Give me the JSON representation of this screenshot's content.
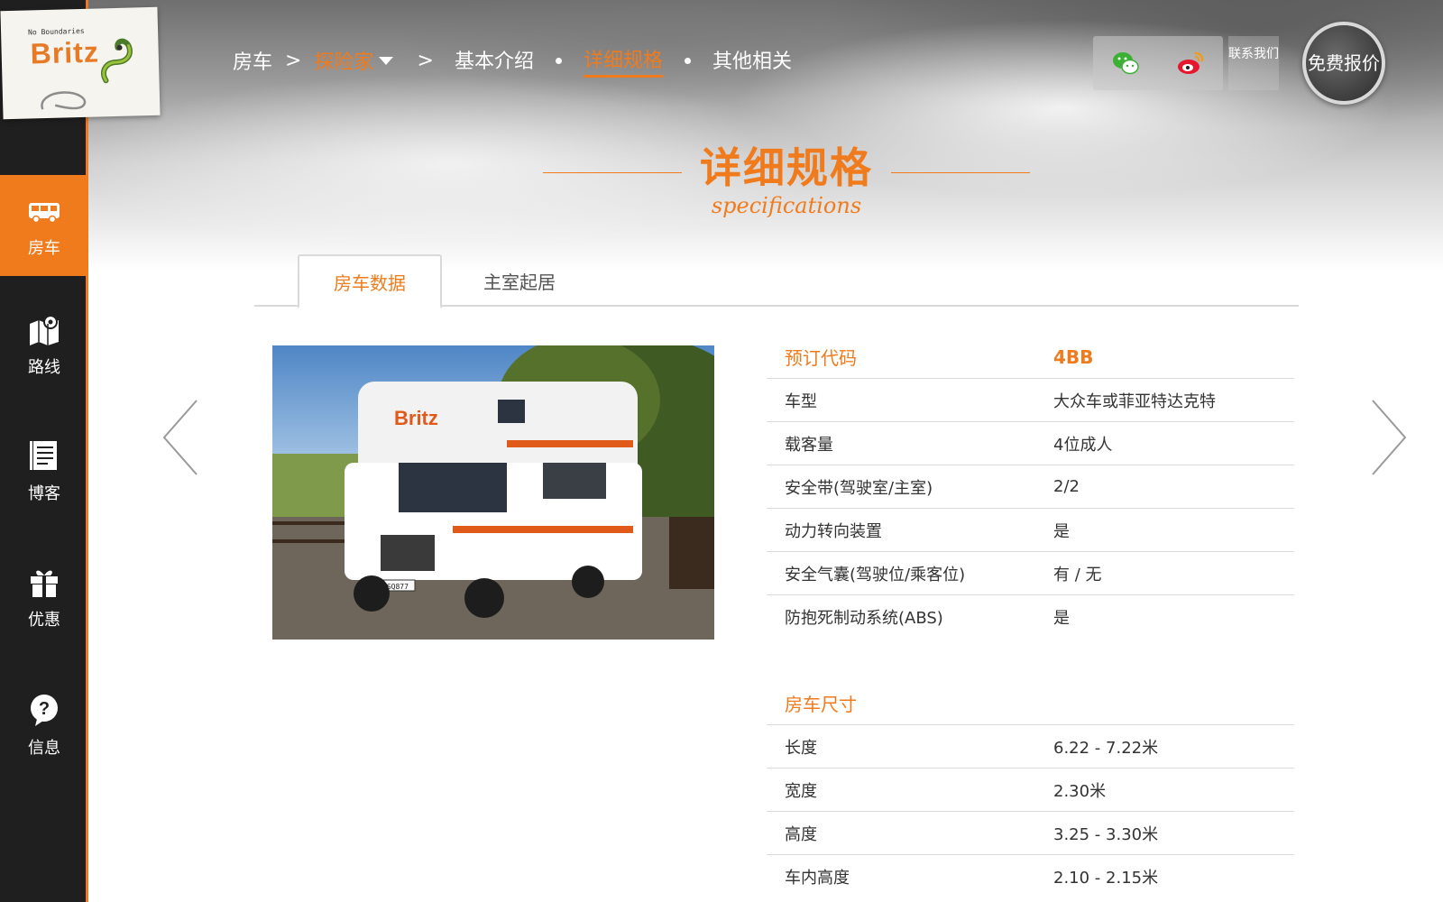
{
  "logo": {
    "tagline": "No Boundaries",
    "brand": "Britz"
  },
  "sidebar": {
    "items": [
      {
        "label": "房车",
        "icon": "campervan-icon",
        "active": true
      },
      {
        "label": "路线",
        "icon": "map-pin-icon",
        "active": false
      },
      {
        "label": "博客",
        "icon": "notes-icon",
        "active": false
      },
      {
        "label": "优惠",
        "icon": "gift-icon",
        "active": false
      },
      {
        "label": "信息",
        "icon": "question-icon",
        "active": false
      }
    ]
  },
  "breadcrumb": {
    "root": "房车",
    "current": "探险家",
    "sep": ">"
  },
  "subnav": {
    "items": [
      "基本介绍",
      "详细规格",
      "其他相关"
    ],
    "active_index": 1
  },
  "header": {
    "contact_label": "联系我们",
    "quote_label": "免费报价"
  },
  "section": {
    "title_cn": "详细规格",
    "title_en": "specifications"
  },
  "tabs": {
    "items": [
      "房车数据",
      "主室起居"
    ],
    "active_index": 0
  },
  "photo": {
    "brand_text": "Britz",
    "plate": "FSQ877"
  },
  "specs": {
    "general": {
      "head_key": "预订代码",
      "head_value": "4BB",
      "rows": [
        {
          "k": "车型",
          "v": "大众车或菲亚特达克特"
        },
        {
          "k": "载客量",
          "v": "4位成人"
        },
        {
          "k": "安全带(驾驶室/主室)",
          "v": "2/2"
        },
        {
          "k": "动力转向装置",
          "v": "是"
        },
        {
          "k": "安全气囊(驾驶位/乘客位)",
          "v": "有 / 无"
        },
        {
          "k": "防抱死制动系统(ABS)",
          "v": "是"
        }
      ]
    },
    "dimensions": {
      "head_key": "房车尺寸",
      "rows": [
        {
          "k": "长度",
          "v": "6.22 - 7.22米"
        },
        {
          "k": "宽度",
          "v": "2.30米"
        },
        {
          "k": "高度",
          "v": "3.25 - 3.30米"
        },
        {
          "k": "车内高度",
          "v": "2.10 - 2.15米"
        }
      ]
    }
  },
  "colors": {
    "accent": "#f07b1d",
    "sidebar": "#1f1f1f",
    "divider": "#dcdcdc"
  }
}
